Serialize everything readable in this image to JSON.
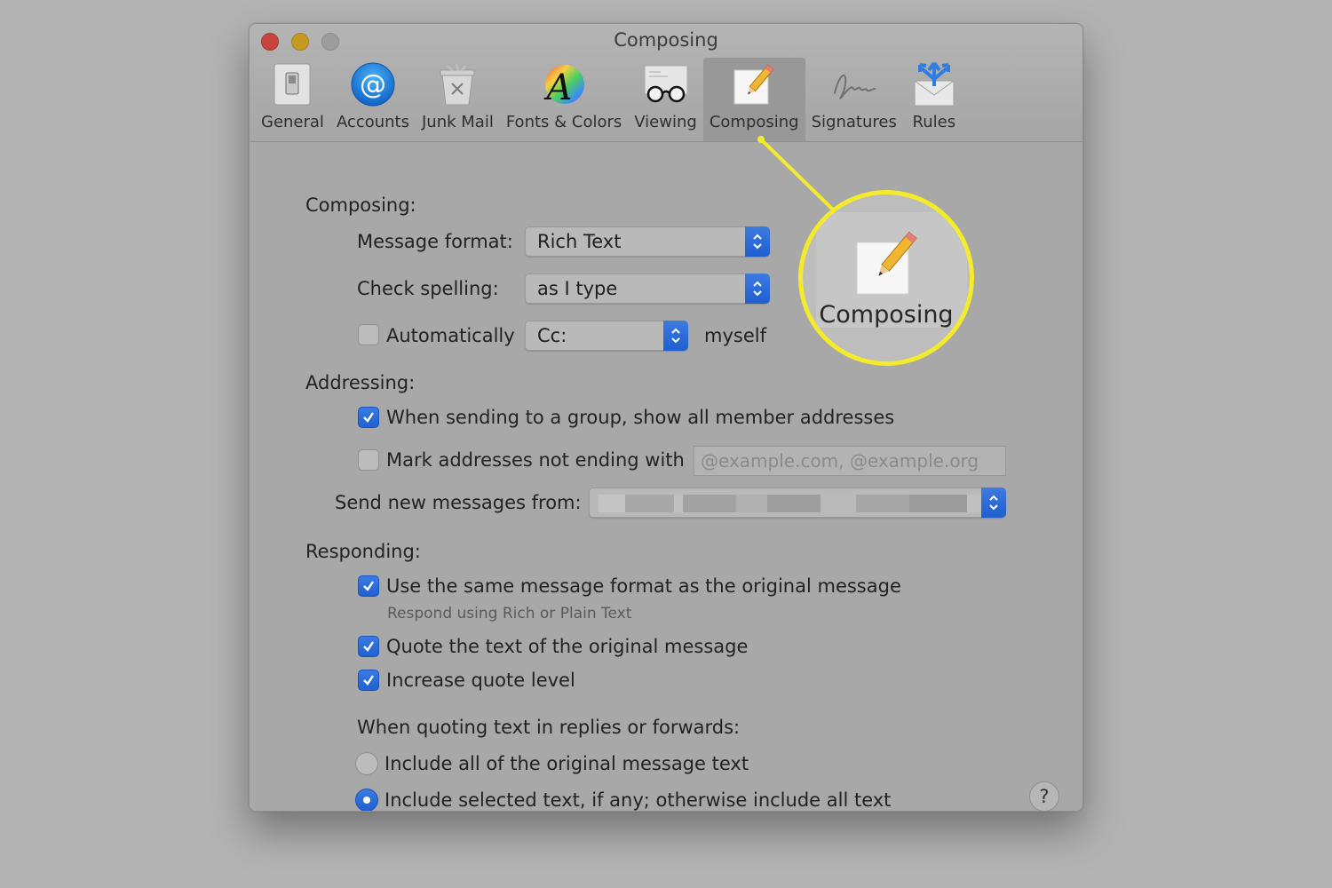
{
  "window": {
    "title": "Composing",
    "traffic_lights": [
      "close",
      "minimize",
      "zoom"
    ]
  },
  "toolbar": {
    "items": [
      {
        "label": "General",
        "icon": "switch-icon"
      },
      {
        "label": "Accounts",
        "icon": "at-sign-icon"
      },
      {
        "label": "Junk Mail",
        "icon": "trash-icon"
      },
      {
        "label": "Fonts & Colors",
        "icon": "font-color-icon"
      },
      {
        "label": "Viewing",
        "icon": "glasses-icon"
      },
      {
        "label": "Composing",
        "icon": "pencil-icon",
        "active": true
      },
      {
        "label": "Signatures",
        "icon": "signature-icon"
      },
      {
        "label": "Rules",
        "icon": "rules-envelope-icon"
      }
    ]
  },
  "composing": {
    "heading": "Composing:",
    "message_format_label": "Message format:",
    "message_format_value": "Rich Text",
    "check_spelling_label": "Check spelling:",
    "check_spelling_value": "as I type",
    "auto_cc_checked": false,
    "auto_cc_label": "Automatically",
    "auto_cc_value": "Cc:",
    "auto_cc_suffix": "myself"
  },
  "addressing": {
    "heading": "Addressing:",
    "group_checked": true,
    "group_label": "When sending to a group, show all member addresses",
    "mark_checked": false,
    "mark_label": "Mark addresses not ending with",
    "mark_placeholder": "@example.com, @example.org",
    "send_from_label": "Send new messages from:",
    "send_from_value": ""
  },
  "responding": {
    "heading": "Responding:",
    "same_format_checked": true,
    "same_format_label": "Use the same message format as the original message",
    "same_format_sub": "Respond using Rich or Plain Text",
    "quote_checked": true,
    "quote_label": "Quote the text of the original message",
    "increase_checked": true,
    "increase_label": "Increase quote level",
    "quoting_heading": "When quoting text in replies or forwards:",
    "options": [
      {
        "label": "Include all of the original message text",
        "selected": false
      },
      {
        "label": "Include selected text, if any; otherwise include all text",
        "selected": true
      }
    ]
  },
  "help_label": "?",
  "callout": {
    "label": "Composing",
    "color": "#f4ec2a"
  },
  "colors": {
    "accent": "#2563d4",
    "highlight": "#f4ec2a"
  }
}
